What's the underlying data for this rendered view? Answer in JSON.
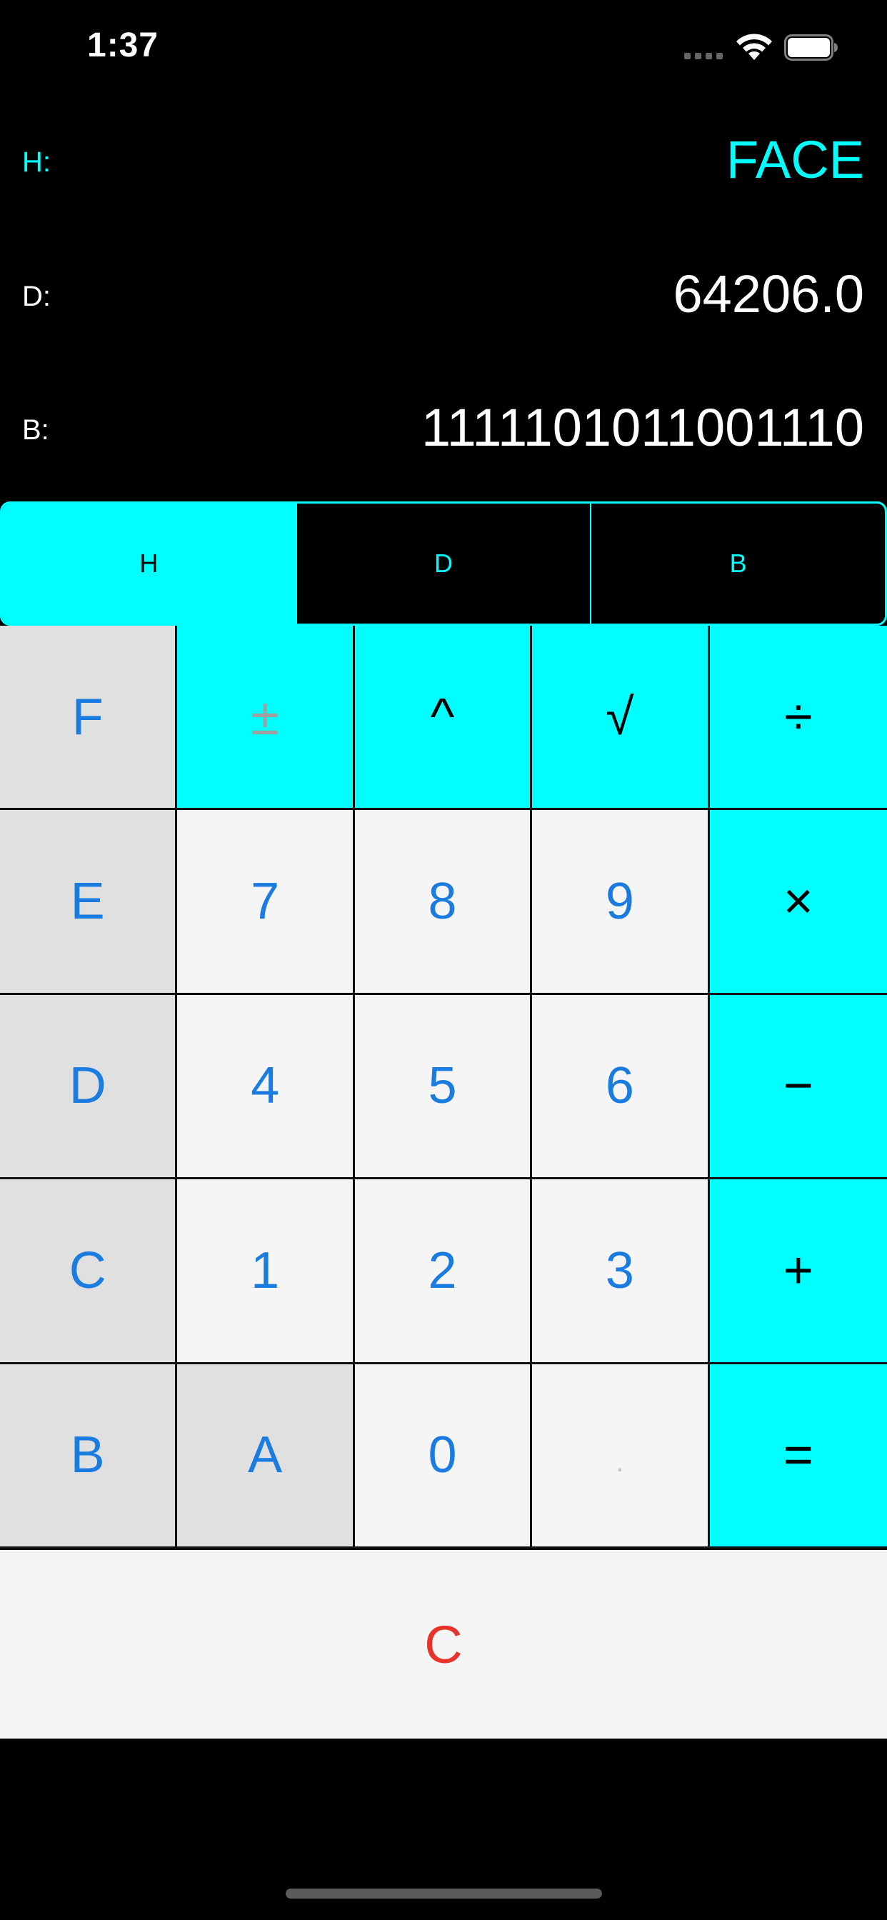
{
  "status_bar": {
    "time": "1:37",
    "icons": [
      "signal-icon",
      "wifi-icon",
      "battery-icon"
    ]
  },
  "display": {
    "hex": {
      "label": "H:",
      "value": "FACE"
    },
    "decimal": {
      "label": "D:",
      "value": "64206.0"
    },
    "binary": {
      "label": "B:",
      "value": "1111101011001110"
    }
  },
  "base_selector": {
    "options": [
      "H",
      "D",
      "B"
    ],
    "selected": "H"
  },
  "keypad": {
    "rows": [
      [
        "F",
        "±",
        "^",
        "√",
        "÷"
      ],
      [
        "E",
        "7",
        "8",
        "9",
        "×"
      ],
      [
        "D",
        "4",
        "5",
        "6",
        "−"
      ],
      [
        "C",
        "1",
        "2",
        "3",
        "+"
      ],
      [
        "B",
        "A",
        "0",
        ".",
        "="
      ]
    ]
  },
  "clear_label": "C",
  "colors": {
    "accent": "#00ffff",
    "key_text": "#1a7be0",
    "clear_text": "#e8322a",
    "hex_key_bg": "#e0e0e0",
    "num_key_bg": "#f5f5f5",
    "background": "#000000"
  }
}
